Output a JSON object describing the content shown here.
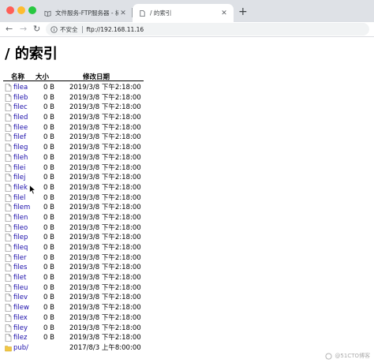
{
  "tabs": [
    {
      "title": "文件服务-FTP服务器 - 树明聊",
      "active": false
    },
    {
      "title": "/ 的索引",
      "active": true
    }
  ],
  "toolbar": {
    "security_label": "不安全",
    "url": "ftp://192.168.11.16"
  },
  "page": {
    "title": "/ 的索引",
    "headers": {
      "name": "名称",
      "size": "大小",
      "date": "修改日期"
    },
    "files": [
      {
        "name": "filea",
        "size": "0 B",
        "date": "2019/3/8 下午2:18:00",
        "type": "file"
      },
      {
        "name": "fileb",
        "size": "0 B",
        "date": "2019/3/8 下午2:18:00",
        "type": "file"
      },
      {
        "name": "filec",
        "size": "0 B",
        "date": "2019/3/8 下午2:18:00",
        "type": "file"
      },
      {
        "name": "filed",
        "size": "0 B",
        "date": "2019/3/8 下午2:18:00",
        "type": "file"
      },
      {
        "name": "filee",
        "size": "0 B",
        "date": "2019/3/8 下午2:18:00",
        "type": "file"
      },
      {
        "name": "filef",
        "size": "0 B",
        "date": "2019/3/8 下午2:18:00",
        "type": "file"
      },
      {
        "name": "fileg",
        "size": "0 B",
        "date": "2019/3/8 下午2:18:00",
        "type": "file"
      },
      {
        "name": "fileh",
        "size": "0 B",
        "date": "2019/3/8 下午2:18:00",
        "type": "file"
      },
      {
        "name": "filei",
        "size": "0 B",
        "date": "2019/3/8 下午2:18:00",
        "type": "file"
      },
      {
        "name": "filej",
        "size": "0 B",
        "date": "2019/3/8 下午2:18:00",
        "type": "file"
      },
      {
        "name": "filek",
        "size": "0 B",
        "date": "2019/3/8 下午2:18:00",
        "type": "file"
      },
      {
        "name": "filel",
        "size": "0 B",
        "date": "2019/3/8 下午2:18:00",
        "type": "file"
      },
      {
        "name": "filem",
        "size": "0 B",
        "date": "2019/3/8 下午2:18:00",
        "type": "file"
      },
      {
        "name": "filen",
        "size": "0 B",
        "date": "2019/3/8 下午2:18:00",
        "type": "file"
      },
      {
        "name": "fileo",
        "size": "0 B",
        "date": "2019/3/8 下午2:18:00",
        "type": "file"
      },
      {
        "name": "filep",
        "size": "0 B",
        "date": "2019/3/8 下午2:18:00",
        "type": "file"
      },
      {
        "name": "fileq",
        "size": "0 B",
        "date": "2019/3/8 下午2:18:00",
        "type": "file"
      },
      {
        "name": "filer",
        "size": "0 B",
        "date": "2019/3/8 下午2:18:00",
        "type": "file"
      },
      {
        "name": "files",
        "size": "0 B",
        "date": "2019/3/8 下午2:18:00",
        "type": "file"
      },
      {
        "name": "filet",
        "size": "0 B",
        "date": "2019/3/8 下午2:18:00",
        "type": "file"
      },
      {
        "name": "fileu",
        "size": "0 B",
        "date": "2019/3/8 下午2:18:00",
        "type": "file"
      },
      {
        "name": "filev",
        "size": "0 B",
        "date": "2019/3/8 下午2:18:00",
        "type": "file"
      },
      {
        "name": "filew",
        "size": "0 B",
        "date": "2019/3/8 下午2:18:00",
        "type": "file"
      },
      {
        "name": "filex",
        "size": "0 B",
        "date": "2019/3/8 下午2:18:00",
        "type": "file"
      },
      {
        "name": "filey",
        "size": "0 B",
        "date": "2019/3/8 下午2:18:00",
        "type": "file"
      },
      {
        "name": "filez",
        "size": "0 B",
        "date": "2019/3/8 下午2:18:00",
        "type": "file"
      },
      {
        "name": "pub/",
        "size": "",
        "date": "2017/8/3 上午8:00:00",
        "type": "folder"
      }
    ]
  },
  "watermark": "@51CTO博客",
  "icons": {
    "file": "file-icon",
    "folder": "folder-icon",
    "info": "info-icon"
  },
  "colors": {
    "link": "#1a0dab",
    "folder": "#f2c744",
    "tabbar": "#dee1e6"
  }
}
